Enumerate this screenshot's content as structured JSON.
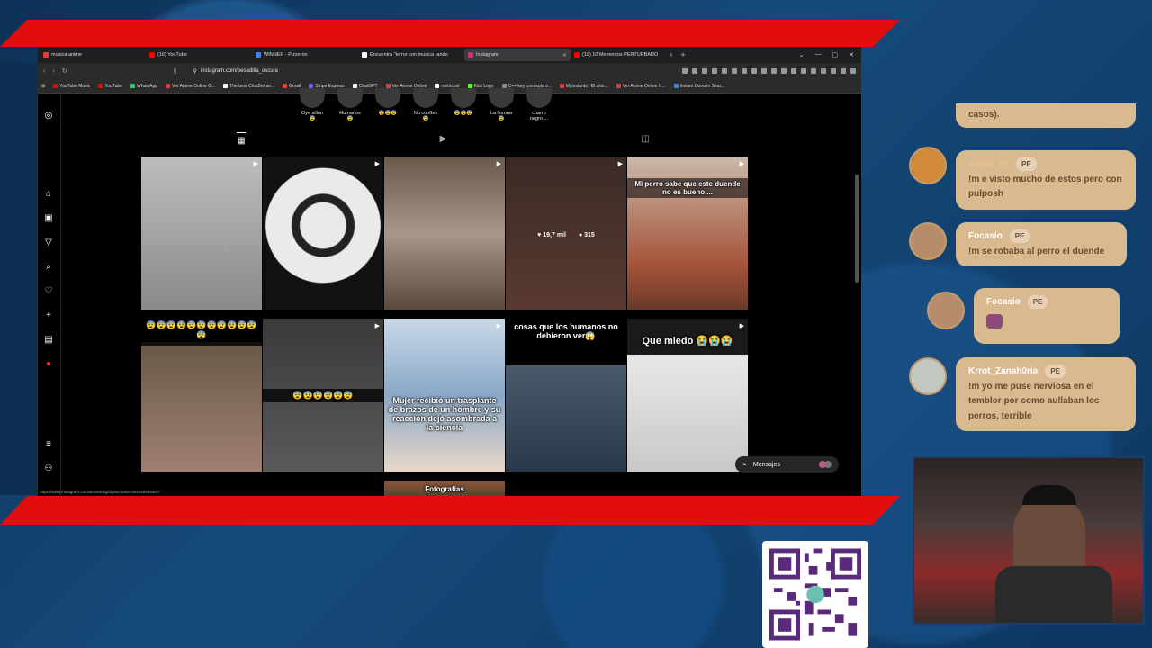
{
  "browser": {
    "tabs": [
      {
        "label": "musica anime",
        "color": "#e63b3b",
        "active": false
      },
      {
        "label": "(16) YouTube",
        "color": "#ff0000",
        "active": false
      },
      {
        "label": "WINNER - Pizzerón",
        "color": "#3b82f6",
        "active": false
      },
      {
        "label": "Encuentra \"terror con musica rando",
        "color": "#ffffff",
        "active": false
      },
      {
        "label": "Instagram",
        "color": "#d62976",
        "active": true
      },
      {
        "label": "(19) 10 Momentos PERTURBADO",
        "color": "#ff0000",
        "active": false
      }
    ],
    "new_tab": "+",
    "url": "instagram.com/pesadilla_oscura",
    "bookmarks": [
      {
        "label": "YouTube Music",
        "color": "#ff0000"
      },
      {
        "label": "YouTube",
        "color": "#ff0000"
      },
      {
        "label": "WhatsApp",
        "color": "#25d366"
      },
      {
        "label": "Ver Anime Online G...",
        "color": "#e04040"
      },
      {
        "label": "The best ChatBot an...",
        "color": "#ffffff"
      },
      {
        "label": "Gmail",
        "color": "#ea4335"
      },
      {
        "label": "Stripe Express",
        "color": "#635bff"
      },
      {
        "label": "ChatGPT",
        "color": "#ffffff"
      },
      {
        "label": "Ver Anime Online",
        "color": "#e04040"
      },
      {
        "label": "metricool",
        "color": "#ffffff"
      },
      {
        "label": "Kick Logo",
        "color": "#53fc18"
      },
      {
        "label": "C++ key concepts o...",
        "color": "#888888"
      },
      {
        "label": "Myinstants | El sitio...",
        "color": "#e63b3b"
      },
      {
        "label": "Ver Anime Online H...",
        "color": "#e04040"
      },
      {
        "label": "Instant Domain Sear...",
        "color": "#3b82f6"
      }
    ],
    "status_url": "https://www.instagram.com/stories/highlights/18057904258645367/"
  },
  "instagram": {
    "highlights": [
      "Oye sillón 😨",
      "Humanos 😨",
      "😨😨😨",
      "No confíes 😨",
      "😨😨😨",
      "La llorona 😨",
      "charro negro ..."
    ],
    "mensajes_label": "Mensajes",
    "posts": [
      {
        "caption": "",
        "likes": "",
        "comments": ""
      },
      {
        "caption": "",
        "likes": "",
        "comments": ""
      },
      {
        "caption": "",
        "likes": "",
        "comments": ""
      },
      {
        "caption": "",
        "likes": "19,7 mil",
        "comments": "315"
      },
      {
        "caption": "Mi perro sabe que este duende no es bueno....",
        "likes": "",
        "comments": ""
      },
      {
        "caption": "😨😨😨😨😨😨😨😨😨😨😨😨",
        "likes": "",
        "comments": ""
      },
      {
        "caption": "😨😨😨😨😨😨",
        "likes": "",
        "comments": ""
      },
      {
        "caption": "Mujer recibió un trasplante de brazos de un hombre y su reacción dejó asombrada a la ciencia",
        "likes": "",
        "comments": ""
      },
      {
        "caption": "cosas que los humanos no debieron ver😱",
        "likes": "",
        "comments": ""
      },
      {
        "caption": "Que miedo 😭😭😭",
        "likes": "",
        "comments": ""
      },
      {
        "caption": "Fotografías",
        "likes": "",
        "comments": ""
      }
    ]
  },
  "chat": [
    {
      "username": "",
      "badge": "",
      "text": "casos)."
    },
    {
      "username": "estela_09",
      "badge": "PE",
      "text": "!m e visto mucho de estos pero con pulposh"
    },
    {
      "username": "Focasio",
      "badge": "PE",
      "text": "!m se robaba al perro el duende"
    },
    {
      "username": "Focasio",
      "badge": "PE",
      "text": ""
    },
    {
      "username": "Krrot_Zanah0ria",
      "badge": "PE",
      "text": "!m yo me puse nerviosa en el temblor por como aullaban los perros, terrible"
    }
  ]
}
